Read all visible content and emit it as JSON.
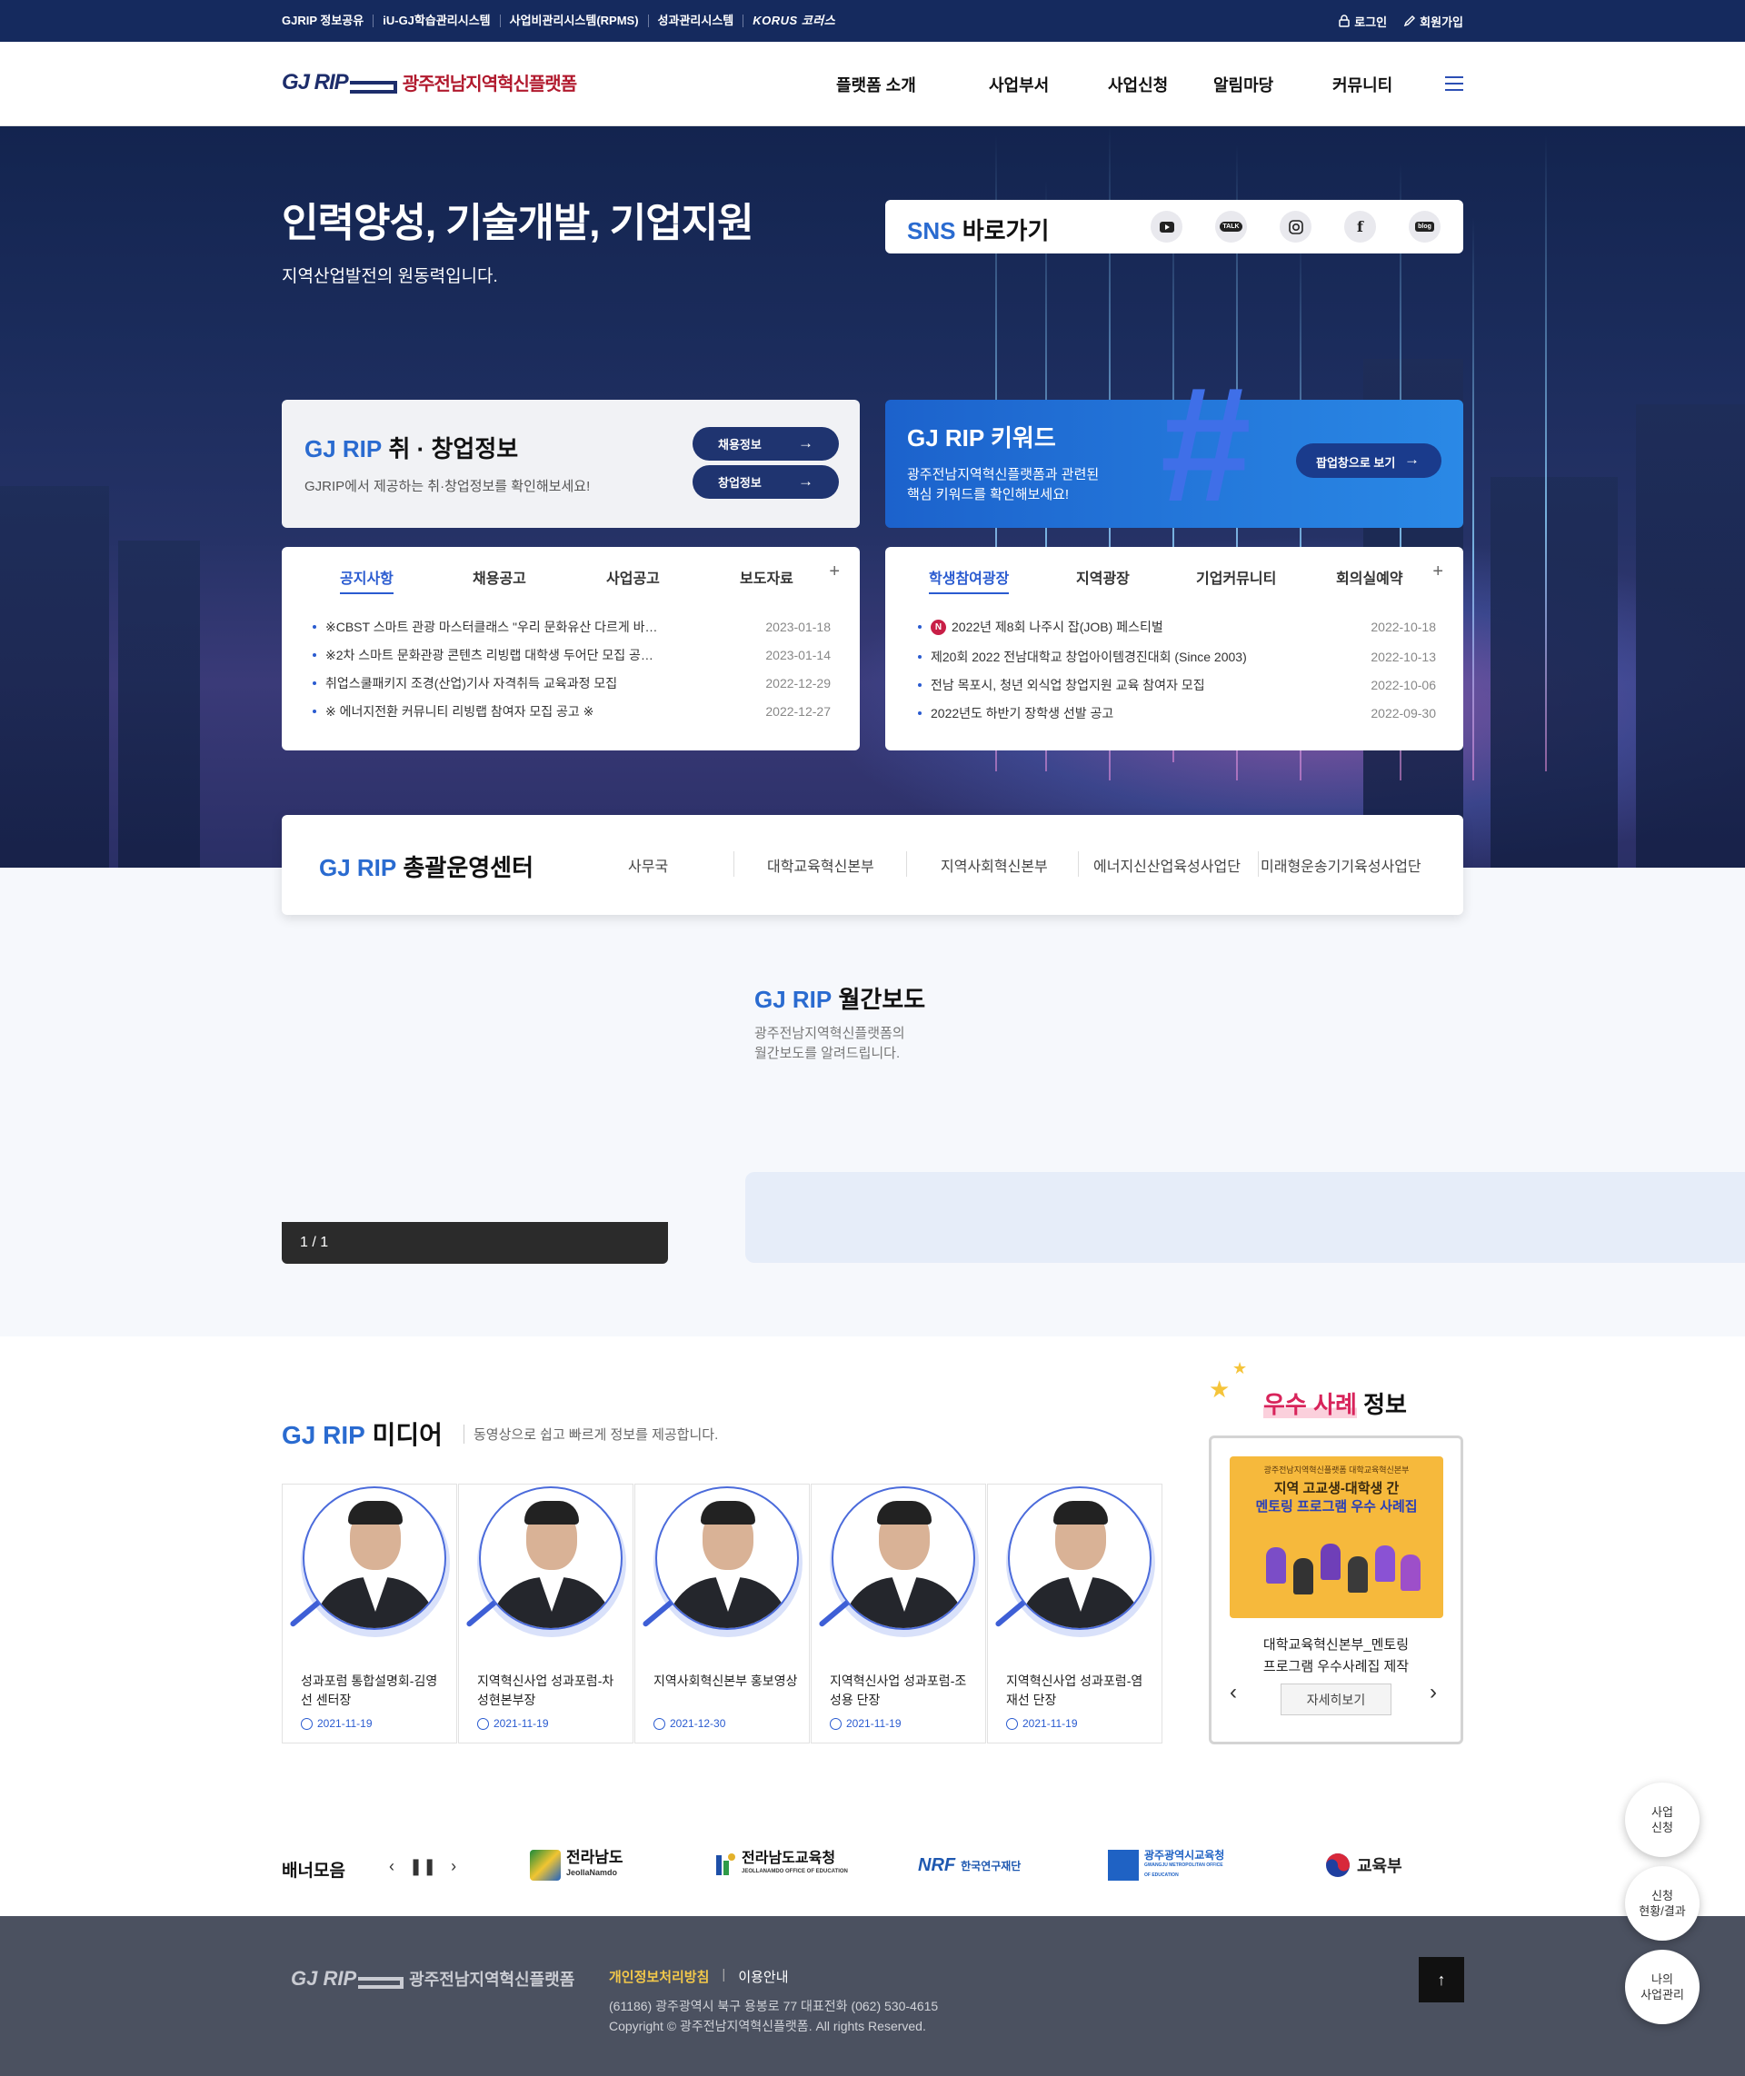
{
  "util": {
    "links": [
      "GJRIP 정보공유",
      "iU-GJ학습관리시스템",
      "사업비관리시스템(RPMS)",
      "성과관리시스템",
      "KORUS 코러스"
    ],
    "login": "로그인",
    "signup": "회원가입"
  },
  "header": {
    "logo_mark": "GJ RIP",
    "logo_text": "광주전남지역혁신플랫폼",
    "menu": [
      "플랫폼 소개",
      "사업부서",
      "사업신청",
      "알림마당",
      "커뮤니티"
    ]
  },
  "hero": {
    "title": "인력양성, 기술개발, 기업지원",
    "subtitle": "지역산업발전의 원동력입니다."
  },
  "sns": {
    "title_accent": "SNS",
    "title_rest": "바로가기",
    "icons": [
      "youtube-icon",
      "kakaotalk-icon",
      "instagram-icon",
      "facebook-icon",
      "blog-icon"
    ],
    "talk_label": "TALK",
    "blog_label": "blog"
  },
  "job": {
    "title_accent": "GJ RIP",
    "title_rest": "취 · 창업정보",
    "desc": "GJRIP에서 제공하는 취·창업정보를 확인해보세요!",
    "btn1": "채용정보",
    "btn2": "창업정보"
  },
  "keyword": {
    "title": "GJ RIP 키워드",
    "desc1": "광주전남지역혁신플랫폼과 관련된",
    "desc2": "핵심 키워드를 확인해보세요!",
    "btn": "팝업창으로 보기"
  },
  "notice": {
    "tabs": [
      "공지사항",
      "채용공고",
      "사업공고",
      "보도자료"
    ],
    "plus": "+",
    "rows": [
      {
        "title": "※CBST 스마트 관광 마스터클래스 \"우리 문화유산 다르게 바…",
        "date": "2023-01-18"
      },
      {
        "title": "※2차 스마트 문화관광 콘텐츠 리빙랩 대학생 두어단 모집 공…",
        "date": "2023-01-14"
      },
      {
        "title": "취업스쿨패키지 조경(산업)기사 자격취득 교육과정 모집",
        "date": "2022-12-29"
      },
      {
        "title": "※ 에너지전환 커뮤니티 리빙랩 참여자 모집 공고 ※",
        "date": "2022-12-27"
      }
    ]
  },
  "community": {
    "tabs": [
      "학생참여광장",
      "지역광장",
      "기업커뮤니티",
      "회의실예약"
    ],
    "plus": "+",
    "new_badge": "N",
    "rows": [
      {
        "title": "2022년 제8회 나주시 잡(JOB) 페스티벌",
        "date": "2022-10-18"
      },
      {
        "title": "제20회 2022 전남대학교 창업아이템경진대회 (Since 2003)",
        "date": "2022-10-13"
      },
      {
        "title": "전남 목포시, 청년 외식업 창업지원 교육 참여자 모집",
        "date": "2022-10-06"
      },
      {
        "title": "2022년도 하반기 장학생 선발 공고",
        "date": "2022-09-30"
      }
    ]
  },
  "center": {
    "title_accent": "GJ RIP",
    "title_rest": "총괄운영센터",
    "items": [
      "사무국",
      "대학교육혁신본부",
      "지역사회혁신본부",
      "에너지신산업육성사업단",
      "미래형운송기기육성사업단"
    ]
  },
  "monthly": {
    "title_accent": "GJ RIP",
    "title_rest": "월간보도",
    "desc1": "광주전남지역혁신플랫폼의",
    "desc2": "월간보도를 알려드립니다.",
    "pager": "1 / 1"
  },
  "media": {
    "title_accent": "GJ RIP",
    "title_rest": "미디어",
    "desc": "동영상으로 쉽고 빠르게 정보를 제공합니다.",
    "items": [
      {
        "caption": "성과포럼 통합설명회-김영선 센터장",
        "date": "2021-11-19"
      },
      {
        "caption": "지역혁신사업 성과포럼-차성현본부장",
        "date": "2021-11-19"
      },
      {
        "caption": "지역사회혁신본부 홍보영상",
        "date": "2021-12-30"
      },
      {
        "caption": "지역혁신사업 성과포럼-조성용 단장",
        "date": "2021-11-19"
      },
      {
        "caption": "지역혁신사업 성과포럼-염재선 단장",
        "date": "2021-11-19"
      }
    ]
  },
  "best": {
    "title_accent": "우수 사례",
    "title_rest": "정보",
    "poster_small": "광주전남지역혁신플랫폼 대학교육혁신본부",
    "poster_h1": "지역 고교생-대학생 간",
    "poster_h2": "멘토링 프로그램 우수 사례집",
    "caption1": "대학교육혁신본부_멘토링",
    "caption2": "프로그램 우수사례집 제작",
    "more": "자세히보기"
  },
  "banner": {
    "label": "배너모음",
    "items": [
      {
        "name": "전라남도",
        "sub": "JeollaNamdo"
      },
      {
        "name": "전라남도교육청",
        "sub": "JEOLLANAMDO OFFICE OF EDUCATION"
      },
      {
        "name": "NRF",
        "sub": "한국연구재단"
      },
      {
        "name": "광주광역시교육청",
        "sub": "GWANGJU METROPOLITAN OFFICE OF EDUCATION"
      },
      {
        "name": "교육부",
        "sub": ""
      }
    ]
  },
  "footer": {
    "logo_mark": "GJ RIP",
    "logo_text": "광주전남지역혁신플랫폼",
    "privacy": "개인정보처리방침",
    "terms": "이용안내",
    "address": "(61186) 광주광역시 북구 용봉로 77 대표전화 (062) 530-4615",
    "copyright": "Copyright © 광주전남지역혁신플랫폼. All rights Reserved."
  },
  "quick": [
    "사업\n신청",
    "신청\n현황/결과",
    "나의\n사업관리"
  ],
  "colors": {
    "navy": "#152a5e",
    "accent_blue": "#2a6bd0",
    "brand_red": "#b11a2e"
  }
}
